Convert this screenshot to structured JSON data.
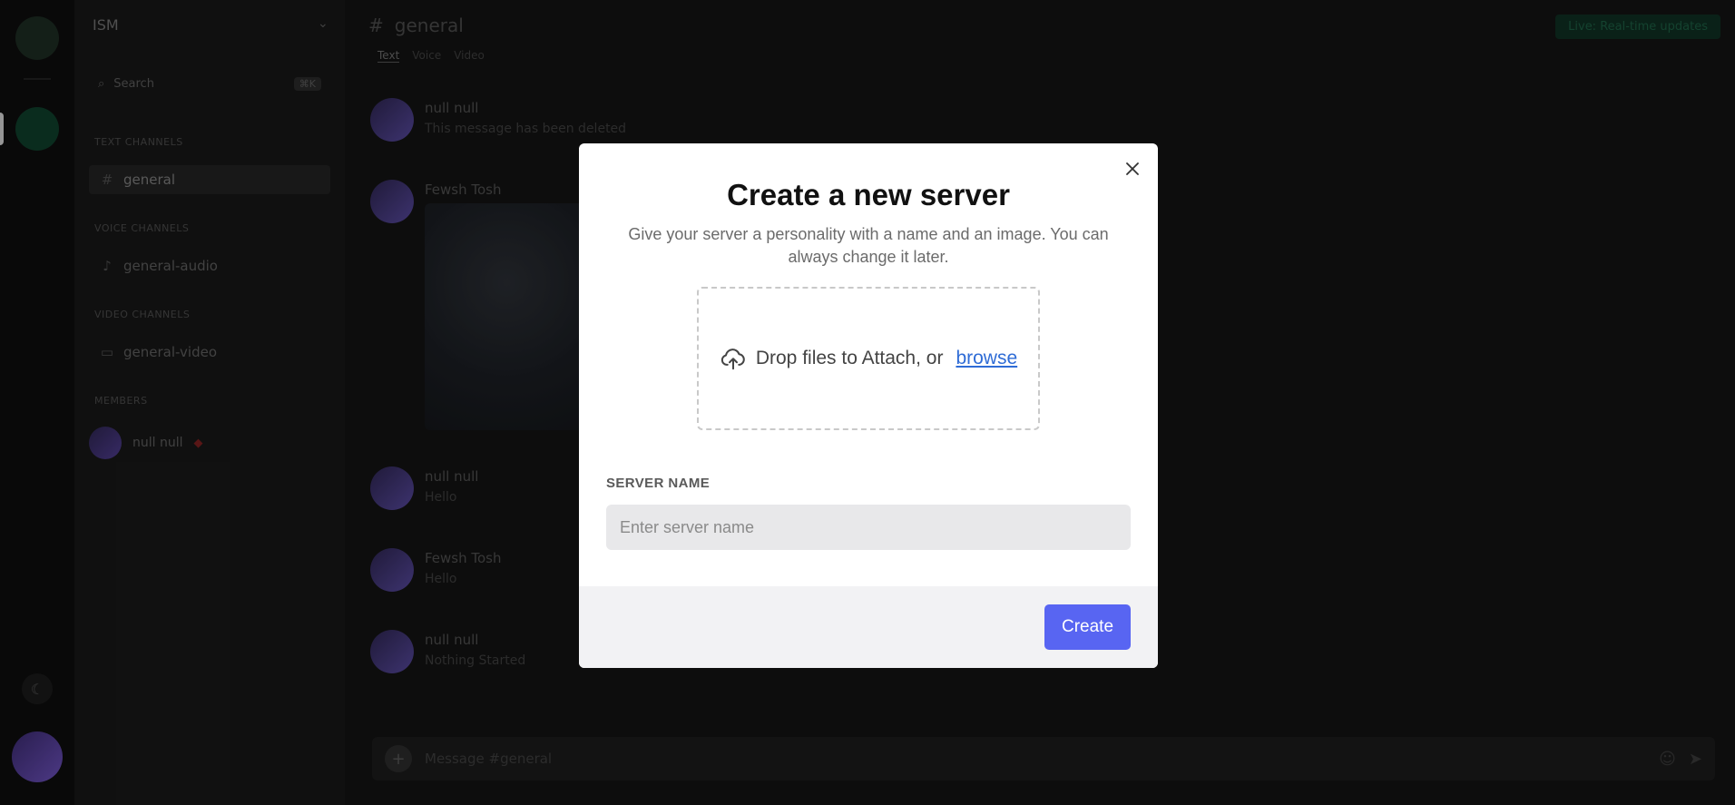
{
  "background_app": {
    "server_name": "ISM",
    "search_label": "Search",
    "search_shortcut": "⌘K",
    "sections": {
      "text_channels": "TEXT CHANNELS",
      "voice_channels": "VOICE CHANNELS",
      "video_channels": "VIDEO CHANNELS",
      "members": "MEMBERS"
    },
    "channels": {
      "text": "general",
      "voice": "general-audio",
      "video": "general-video"
    },
    "member_name": "null null",
    "header_channel": "general",
    "header_tabs": [
      "Text",
      "Voice",
      "Video"
    ],
    "live_badge": "Live: Real-time updates",
    "messages": [
      {
        "name": "null null",
        "text": "This message has been deleted"
      },
      {
        "name": "Fewsh Tosh",
        "text": ""
      },
      {
        "name": "null null",
        "text": "Hello"
      },
      {
        "name": "Fewsh Tosh",
        "text": "Hello"
      },
      {
        "name": "null null",
        "text": "Nothing Started"
      }
    ],
    "input_placeholder": "Message #general"
  },
  "modal": {
    "title": "Create a new server",
    "subtitle": "Give your server a personality with a name and an image. You can always change it later.",
    "dropzone_text": "Drop files to Attach, or",
    "dropzone_link": "browse",
    "field_label": "SERVER NAME",
    "field_value": "",
    "field_placeholder": "Enter server name",
    "create_label": "Create",
    "close_icon": "close-icon",
    "upload_icon": "cloud-upload-icon"
  },
  "colors": {
    "accent": "#5865f2",
    "link": "#2f6cd6",
    "modal_bg": "#ffffff",
    "footer_bg": "#f2f2f4"
  }
}
